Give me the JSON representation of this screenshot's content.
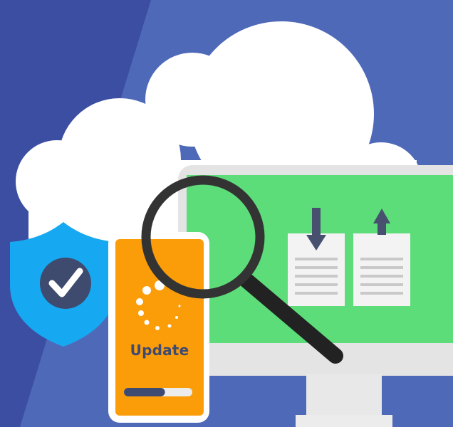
{
  "phone": {
    "label": "Update",
    "progress": 0.6
  },
  "colors": {
    "background_dark": "#3c4ea2",
    "background_light": "#4f69b9",
    "cloud": "#ffffff",
    "monitor_screen": "#5ddc7a",
    "phone_body": "#fb9c09",
    "shield": "#17a8f2",
    "check_badge": "#3e4a6e",
    "magnifier": "#222222",
    "arrow": "#47506e"
  },
  "icons": {
    "shield": "shield-check-icon",
    "magnifier": "magnifying-glass-icon",
    "download": "arrow-down-icon",
    "upload": "arrow-up-icon",
    "cloud": "cloud-icon",
    "monitor": "monitor-icon",
    "spinner": "loading-spinner-icon"
  }
}
